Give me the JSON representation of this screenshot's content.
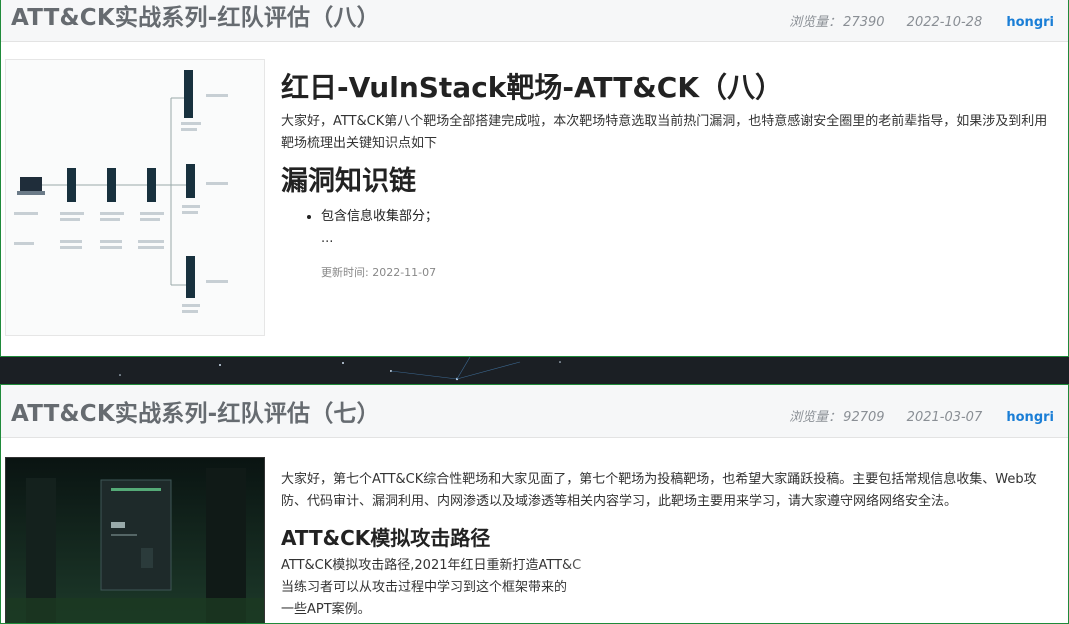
{
  "posts": [
    {
      "title": "ATT&CK实战系列-红队评估（八）",
      "views_label": "浏览量：",
      "views": "27390",
      "date": "2022-10-28",
      "author": "hongri",
      "heading": "红日-VulnStack靶场-ATT&CK（八）",
      "intro": "大家好，ATT&CK第八个靶场全部搭建完成啦，本次靶场特意选取当前热门漏洞，也特意感谢安全圈里的老前辈指导，如果涉及到利用靶场梳理出关键知识点如下",
      "section_heading": "漏洞知识链",
      "bullets": [
        "包含信息收集部分；"
      ],
      "ellipsis": "...",
      "updated": "更新时间: 2022-11-07"
    },
    {
      "title": "ATT&CK实战系列-红队评估（七）",
      "views_label": "浏览量：",
      "views": "92709",
      "date": "2021-03-07",
      "author": "hongri",
      "intro": "大家好，第七个ATT&CK综合性靶场和大家见面了，第七个靶场为投稿靶场，也希望大家踊跃投稿。主要包括常规信息收集、Web攻防、代码审计、漏洞利用、内网渗透以及域渗透等相关内容学习，此靶场主要用来学习，请大家遵守网络网络安全法。",
      "section_heading": "ATT&CK模拟攻击路径",
      "section_text": "ATT&CK模拟攻击路径,2021年红日重新打造ATT&C",
      "section_text_2": "当练习者可以从攻击过程中学习到这个框架带来的",
      "section_text_3": "一些APT案例。"
    }
  ]
}
